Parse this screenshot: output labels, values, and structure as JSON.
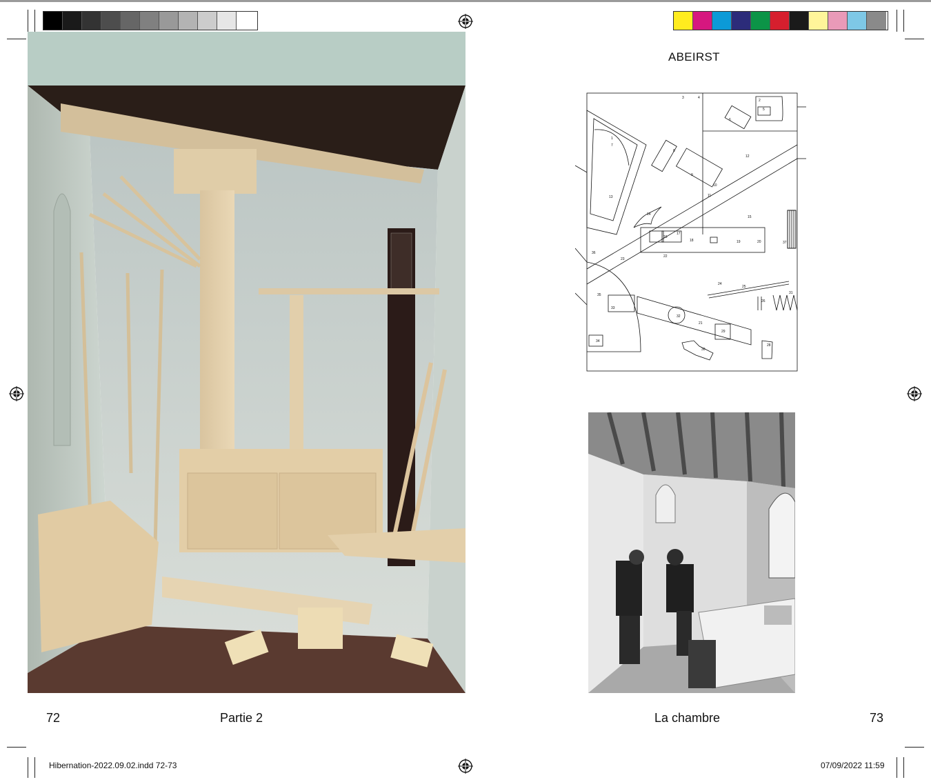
{
  "spread": {
    "left_page": {
      "folio": "72",
      "running_head": "Partie 2",
      "photo_subject": "model-room-photo"
    },
    "right_page": {
      "folio": "73",
      "running_head": "La chambre",
      "plan_title": "ABEIRST",
      "photo_subject": "studio-bw-photo"
    }
  },
  "slug": {
    "file": "Hibernation-2022.09.02.indd   72-73",
    "date": "07/09/2022   11:59"
  },
  "grayscale_bar": [
    "#000000",
    "#1a1a1a",
    "#333333",
    "#4d4d4d",
    "#666666",
    "#808080",
    "#999999",
    "#b3b3b3",
    "#cccccc",
    "#e6e6e6",
    "#ffffff"
  ],
  "color_bar": [
    "#ffec1f",
    "#d6177f",
    "#0c9ad7",
    "#2c2c7a",
    "#0c9447",
    "#d61f2e",
    "#1a1a1a",
    "#fff59a",
    "#e99ab8",
    "#7ec8e6",
    "#8a8a8a"
  ],
  "plan_labels": [
    "1",
    "2",
    "3",
    "4",
    "5",
    "6",
    "7",
    "8",
    "9",
    "10",
    "11",
    "12",
    "13",
    "14",
    "15",
    "16",
    "17",
    "18",
    "19",
    "20",
    "21",
    "22",
    "23",
    "24",
    "25",
    "26",
    "28",
    "29",
    "30",
    "31",
    "32",
    "33",
    "34",
    "35",
    "36",
    "37"
  ]
}
